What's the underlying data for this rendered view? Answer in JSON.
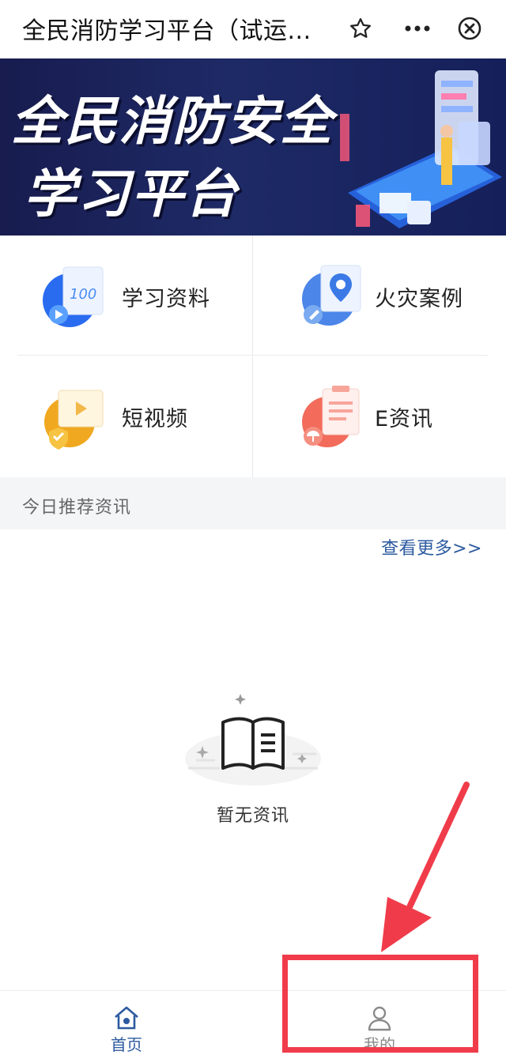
{
  "titlebar": {
    "title": "全民消防学习平台（试运...",
    "icons": {
      "star": "star-icon",
      "more": "more-icon",
      "close": "close-circle-icon"
    }
  },
  "banner": {
    "line1": "全民消防安全",
    "line2": "学习平台"
  },
  "menu": [
    {
      "label": "学习资料",
      "icon": "study-material-icon"
    },
    {
      "label": "火灾案例",
      "icon": "fire-case-icon"
    },
    {
      "label": "短视频",
      "icon": "short-video-icon"
    },
    {
      "label": "E资讯",
      "icon": "e-news-icon"
    }
  ],
  "section": {
    "title": "今日推荐资讯",
    "more_link": "查看更多>>"
  },
  "empty_state": {
    "text": "暂无资讯",
    "icon": "open-book-icon"
  },
  "bottom_nav": {
    "home_label": "首页",
    "mine_label": "我的"
  },
  "colors": {
    "accent": "#2c5aa0",
    "annotation": "#f03c4a",
    "banner_bg": "#1e2a66"
  }
}
